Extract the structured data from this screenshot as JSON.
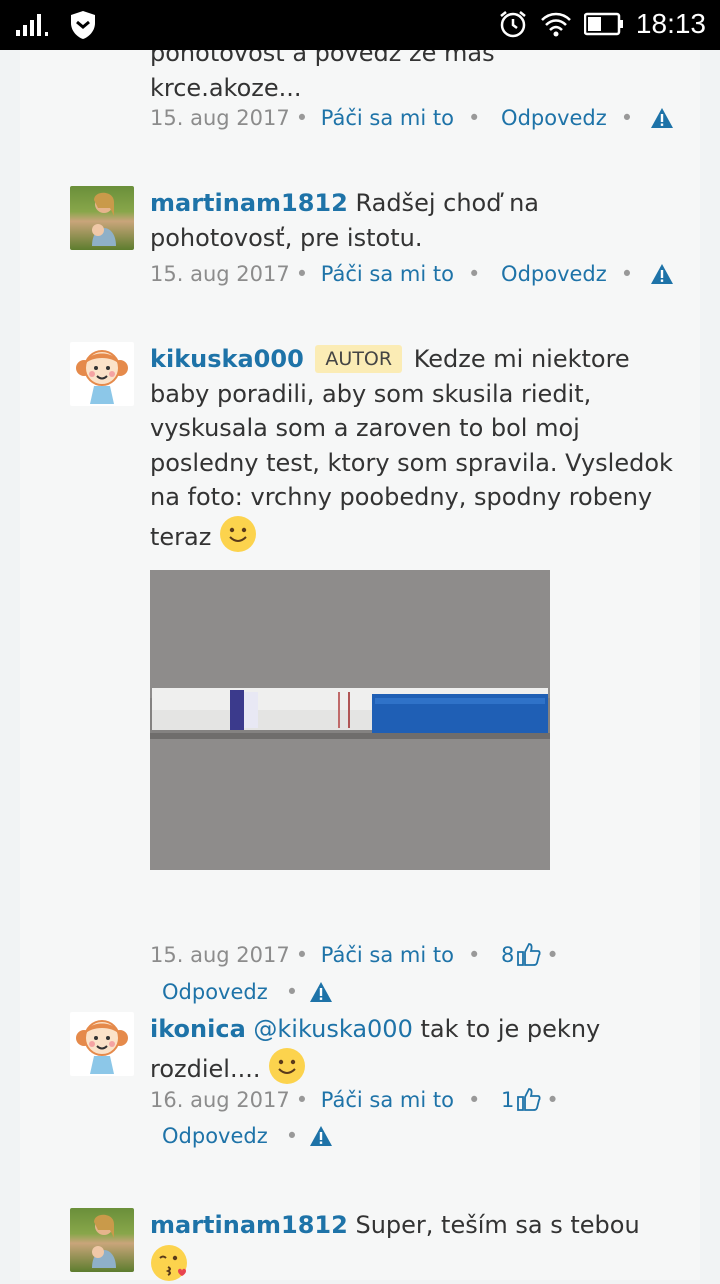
{
  "status_bar": {
    "time": "18:13"
  },
  "comments": [
    {
      "text_part1": "pohotovosť a povedz že máš",
      "text_part2": "krce.akoze...",
      "date": "15. aug 2017",
      "like": "Páči sa mi to",
      "reply": "Odpovedz"
    },
    {
      "user": "martinam1812",
      "text": "Radšej choď na pohotovosť, pre istotu.",
      "date": "15. aug 2017",
      "like": "Páči sa mi to",
      "reply": "Odpovedz"
    },
    {
      "user": "kikuska000",
      "badge": "AUTOR",
      "text": "Kedze mi niektore baby poradili, aby som skusila riedit, vyskusala som a zaroven to bol moj posledny test, ktory som spravila. Vysledok na foto: vrchny poobedny, spodny robeny teraz",
      "date": "15. aug 2017",
      "like": "Páči sa mi to",
      "like_count": "8",
      "reply": "Odpovedz"
    },
    {
      "user": "ikonica",
      "mention": "@kikuska000",
      "text": "tak to je pekny rozdiel....",
      "date": "16. aug 2017",
      "like": "Páči sa mi to",
      "like_count": "1",
      "reply": "Odpovedz"
    },
    {
      "user": "martinam1812",
      "text": "Super, teším sa s tebou"
    }
  ],
  "colors": {
    "link": "#1e73a8",
    "badge_bg": "#fbecb5",
    "meta_gray": "#8c8c8c"
  }
}
